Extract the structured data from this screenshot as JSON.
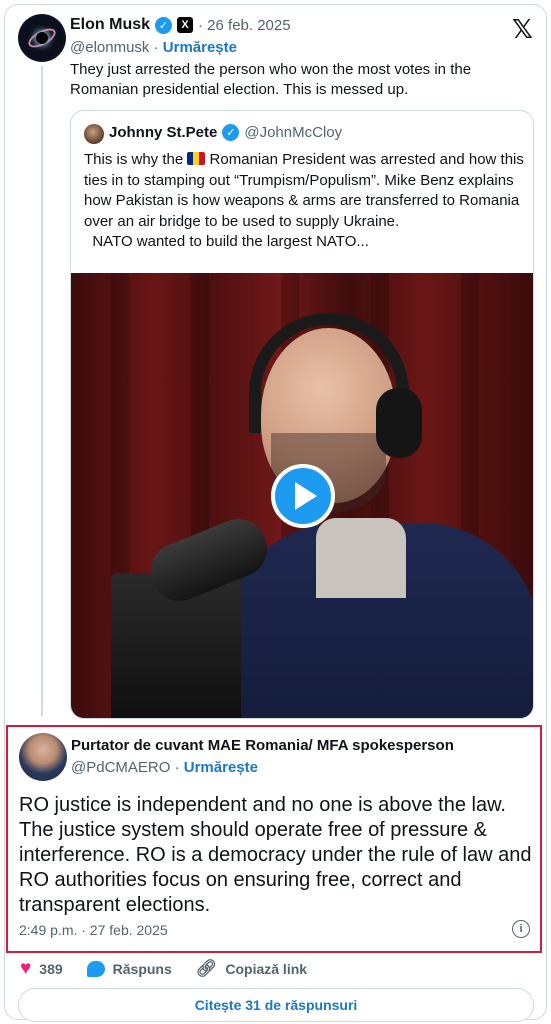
{
  "tweet": {
    "author_name": "Elon Musk",
    "handle": "@elonmusk",
    "date": "· 26 feb. 2025",
    "follow_label": "Urmărește",
    "text": "They just arrested the person who won the most votes in the Romanian presidential election. This is messed up."
  },
  "quote": {
    "author_name": "Johnny St.Pete",
    "handle": "@JohnMcCloy",
    "text_before_flag": "This is why the ",
    "text_after_flag": " Romanian President was arrested and how this ties in to stamping out “Trumpism/Populism”. Mike Benz explains how Pakistan is how weapons & arms are transferred to Romania over an air bridge to be used to supply Ukraine.",
    "text_line2": "NATO wanted to build the largest NATO..."
  },
  "reply": {
    "author_name": "Purtator de cuvant MAE Romania/ MFA spokesperson",
    "handle": "@PdCMAERO",
    "follow_label": "Urmărește",
    "text": "RO justice is independent and no one is above the law. The justice system should operate free of pressure & interference. RO is a democracy under the rule of law and RO authorities focus on ensuring free, correct and transparent elections.",
    "timestamp": "2:49 p.m. · 27 feb. 2025"
  },
  "actions": {
    "likes": "389",
    "reply_label": "Răspuns",
    "copy_link_label": "Copiază link"
  },
  "read_replies_label": "Citește 31 de răspunsuri",
  "colors": {
    "accent_blue": "#1d9bf0",
    "like_pink": "#f91880",
    "highlight_red": "#d11f3b"
  },
  "icons": [
    "verified-icon",
    "x-badge-icon",
    "x-logo-icon",
    "play-icon",
    "heart-icon",
    "reply-bubble-icon",
    "link-icon",
    "info-icon"
  ]
}
